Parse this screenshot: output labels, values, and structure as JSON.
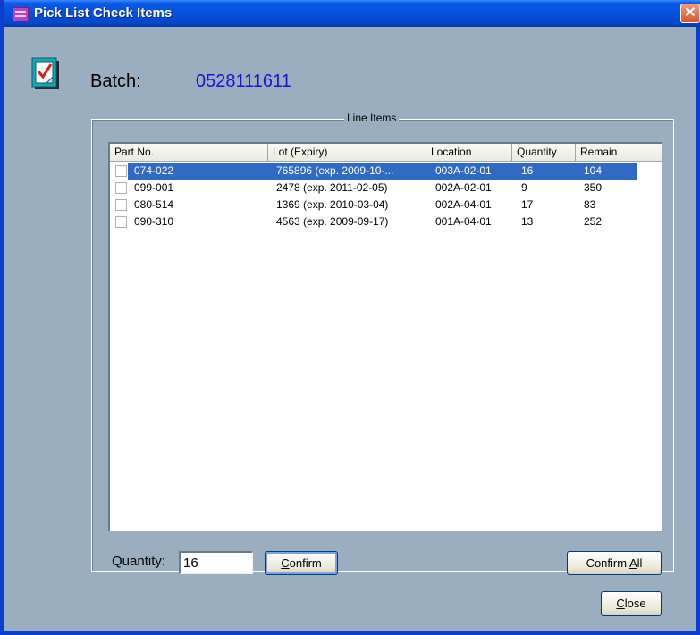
{
  "window": {
    "title": "Pick List Check Items",
    "close_glyph": "✕"
  },
  "batch": {
    "label": "Batch:",
    "value": "0528111611",
    "icon": "checklist-icon"
  },
  "line_items": {
    "legend": "Line Items",
    "columns": [
      "Part No.",
      "Lot (Expiry)",
      "Location",
      "Quantity",
      "Remain"
    ],
    "rows": [
      {
        "part": "074-022",
        "lot": "765896 (exp. 2009-10-...",
        "location": "003A-02-01",
        "quantity": "16",
        "remain": "104",
        "checked": false,
        "selected": true
      },
      {
        "part": "099-001",
        "lot": "2478 (exp. 2011-02-05)",
        "location": "002A-02-01",
        "quantity": "9",
        "remain": "350",
        "checked": false,
        "selected": false
      },
      {
        "part": "080-514",
        "lot": "1369 (exp. 2010-03-04)",
        "location": "002A-04-01",
        "quantity": "17",
        "remain": "83",
        "checked": false,
        "selected": false
      },
      {
        "part": "090-310",
        "lot": "4563 (exp. 2009-09-17)",
        "location": "001A-04-01",
        "quantity": "13",
        "remain": "252",
        "checked": false,
        "selected": false
      }
    ]
  },
  "quantity": {
    "label": "Quantity:",
    "value": "16"
  },
  "buttons": {
    "confirm_first": "C",
    "confirm_rest": "onfirm",
    "confirm_all_main": "Confirm ",
    "confirm_all_ul": "A",
    "confirm_all_rest": "ll",
    "close_first": "C",
    "close_rest": "lose"
  },
  "colors": {
    "selection": "#316ac5",
    "batch_value": "#1515d8",
    "window_bg": "#9aaebf"
  }
}
